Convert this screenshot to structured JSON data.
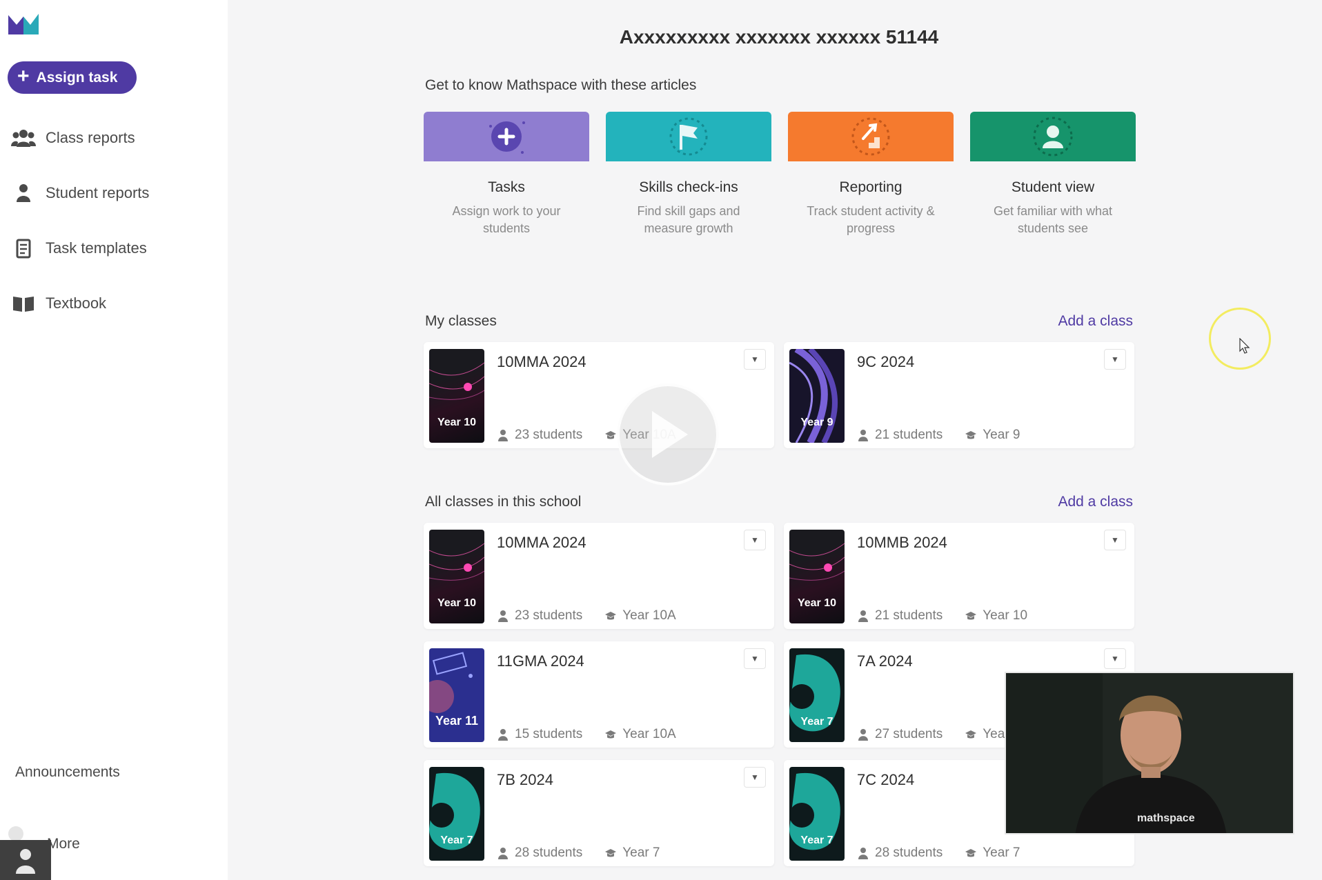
{
  "sidebar": {
    "assign_label": "Assign task",
    "items": [
      {
        "label": "Class reports",
        "icon": "group-icon"
      },
      {
        "label": "Student reports",
        "icon": "person-icon"
      },
      {
        "label": "Task templates",
        "icon": "document-icon"
      },
      {
        "label": "Textbook",
        "icon": "book-icon"
      }
    ],
    "announcements": "Announcements",
    "more": "More"
  },
  "header": {
    "title": "Axxxxxxxxx xxxxxxx xxxxxx 51144"
  },
  "articles": {
    "heading": "Get to know Mathspace with these articles",
    "items": [
      {
        "title": "Tasks",
        "desc": "Assign work to your students",
        "color": "#8f7dd0",
        "icon": "plus-circle-icon"
      },
      {
        "title": "Skills check-ins",
        "desc": "Find skill gaps and measure growth",
        "color": "#23b3bc",
        "icon": "flag-icon"
      },
      {
        "title": "Reporting",
        "desc": "Track student activity & progress",
        "color": "#f57a2e",
        "icon": "stairs-arrow-icon"
      },
      {
        "title": "Student view",
        "desc": "Get familiar with what students see",
        "color": "#16946b",
        "icon": "student-icon"
      }
    ]
  },
  "my_classes": {
    "heading": "My classes",
    "add_label": "Add a class",
    "cards": [
      {
        "name": "10MMA 2024",
        "students": "23 students",
        "year": "Year 10A",
        "cover": "Year 10",
        "theme": "dark-pink"
      },
      {
        "name": "9C 2024",
        "students": "21 students",
        "year": "Year 9",
        "cover": "Year 9",
        "theme": "purple-wave"
      }
    ]
  },
  "all_classes": {
    "heading": "All classes in this school",
    "add_label": "Add a class",
    "cards": [
      {
        "name": "10MMA 2024",
        "students": "23 students",
        "year": "Year 10A",
        "cover": "Year 10",
        "theme": "dark-pink"
      },
      {
        "name": "10MMB 2024",
        "students": "21 students",
        "year": "Year 10",
        "cover": "Year 10",
        "theme": "dark-pink"
      },
      {
        "name": "11GMA 2024",
        "students": "15 students",
        "year": "Year 10A",
        "cover": "Year 11",
        "theme": "navy"
      },
      {
        "name": "7A 2024",
        "students": "27 students",
        "year": "Yea",
        "cover": "Year 7",
        "theme": "teal"
      },
      {
        "name": "7B 2024",
        "students": "28 students",
        "year": "Year 7",
        "cover": "Year 7",
        "theme": "teal"
      },
      {
        "name": "7C 2024",
        "students": "28 students",
        "year": "Year 7",
        "cover": "Year 7",
        "theme": "teal"
      }
    ]
  },
  "webcam": {
    "shirt_text": "mathspace"
  },
  "colors": {
    "accent": "#4f3aa3",
    "background": "#f5f5f6"
  }
}
